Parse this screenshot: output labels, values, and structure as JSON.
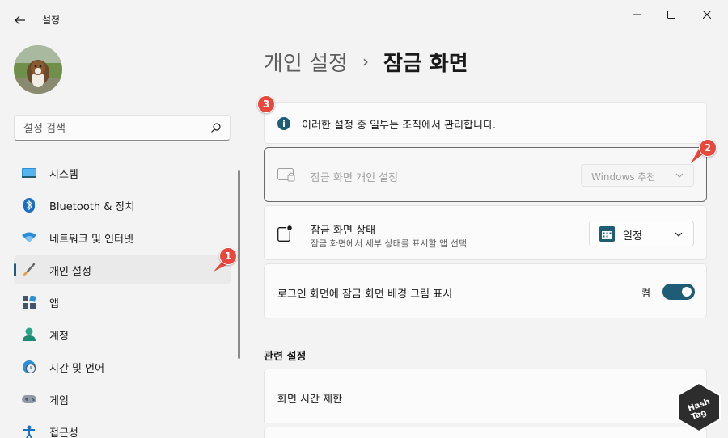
{
  "window": {
    "title": "설정",
    "back_icon": "back-arrow-icon",
    "controls": [
      "minimize-icon",
      "maximize-icon",
      "close-icon"
    ]
  },
  "search": {
    "placeholder": "설정 검색",
    "icon": "search-icon"
  },
  "sidebar": {
    "items": [
      {
        "label": "시스템",
        "icon": "system-display-icon",
        "active": false
      },
      {
        "label": "Bluetooth & 장치",
        "icon": "bluetooth-icon",
        "active": false
      },
      {
        "label": "네트워크 및 인터넷",
        "icon": "wifi-icon",
        "active": false
      },
      {
        "label": "개인 설정",
        "icon": "paintbrush-icon",
        "active": true
      },
      {
        "label": "앱",
        "icon": "apps-icon",
        "active": false
      },
      {
        "label": "계정",
        "icon": "account-icon",
        "active": false
      },
      {
        "label": "시간 및 언어",
        "icon": "clock-globe-icon",
        "active": false
      },
      {
        "label": "게임",
        "icon": "gamepad-icon",
        "active": false
      },
      {
        "label": "접근성",
        "icon": "accessibility-icon",
        "active": false
      }
    ]
  },
  "breadcrumb": {
    "parent": "개인 설정",
    "separator": "›",
    "current": "잠금 화면"
  },
  "info_banner": {
    "icon": "info-icon",
    "text": "이러한 설정 중 일부는 조직에서 관리합니다."
  },
  "lock_personalize": {
    "icon": "lock-screen-icon",
    "label": "잠금 화면 개인 설정",
    "select_value": "Windows 추천",
    "disabled": true
  },
  "lock_status": {
    "icon": "lock-status-icon",
    "label": "잠금 화면 상태",
    "description": "잠금 화면에서 세부 상태를 표시할 앱 선택",
    "select_icon": "calendar-icon",
    "select_value": "일정"
  },
  "login_background": {
    "label": "로그인 화면에 잠금 화면 배경 그림 표시",
    "state_label": "켬",
    "on": true
  },
  "related": {
    "title": "관련 설정",
    "items": [
      {
        "label": "화면 시간 제한"
      }
    ]
  },
  "markers": [
    "1",
    "2",
    "3"
  ],
  "watermark": {
    "text": "Hash Tag"
  },
  "colors": {
    "accent": "#1f5c76",
    "marker": "#e8473e",
    "background": "#f3f3f3",
    "card": "#fbfbfb"
  }
}
